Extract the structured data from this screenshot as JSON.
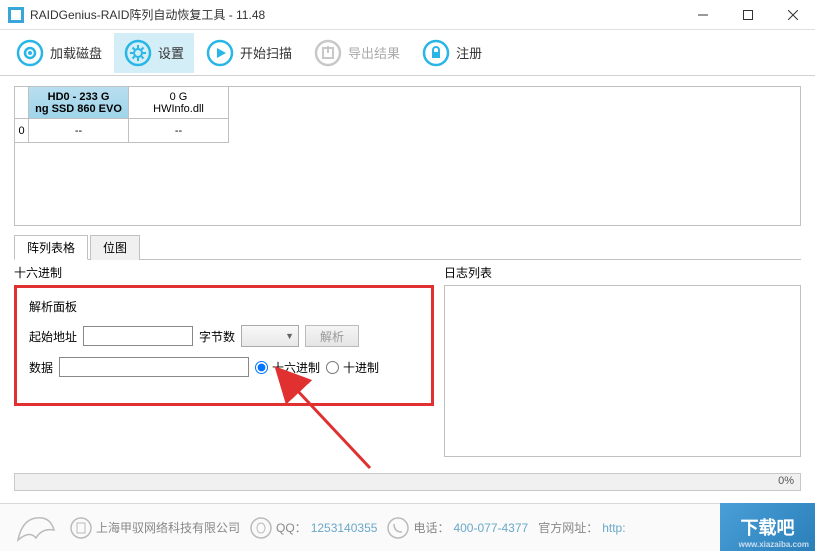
{
  "window": {
    "title": "RAIDGenius-RAID阵列自动恢复工具 - 11.48"
  },
  "toolbar": {
    "load_disk": "加载磁盘",
    "settings": "设置",
    "start_scan": "开始扫描",
    "export_result": "导出结果",
    "register": "注册"
  },
  "disks": {
    "hd0_line1": "HD0 - 233 G",
    "hd0_line2": "ng SSD 860 EVO",
    "hd1_line1": "0 G",
    "hd1_line2": "HWInfo.dll",
    "row_index": "0",
    "dash": "--"
  },
  "tabs": {
    "array_table": "阵列表格",
    "bitmap": "位图"
  },
  "hex": {
    "title": "十六进制",
    "panel_title": "解析面板",
    "start_addr": "起始地址",
    "byte_count": "字节数",
    "parse_btn": "解析",
    "data": "数据",
    "radix_hex": "十六进制",
    "radix_dec": "十进制"
  },
  "log": {
    "title": "日志列表"
  },
  "progress": {
    "percent": "0%"
  },
  "footer": {
    "company": "上海甲驭网络科技有限公司",
    "qq_label": "QQ：",
    "qq": "1253140355",
    "tel_label": "电话：",
    "tel": "400-077-4377",
    "site_label": "官方网址：",
    "site": "http:",
    "badge": "下载吧",
    "badge_sub": "www.xiazaiba.com"
  }
}
